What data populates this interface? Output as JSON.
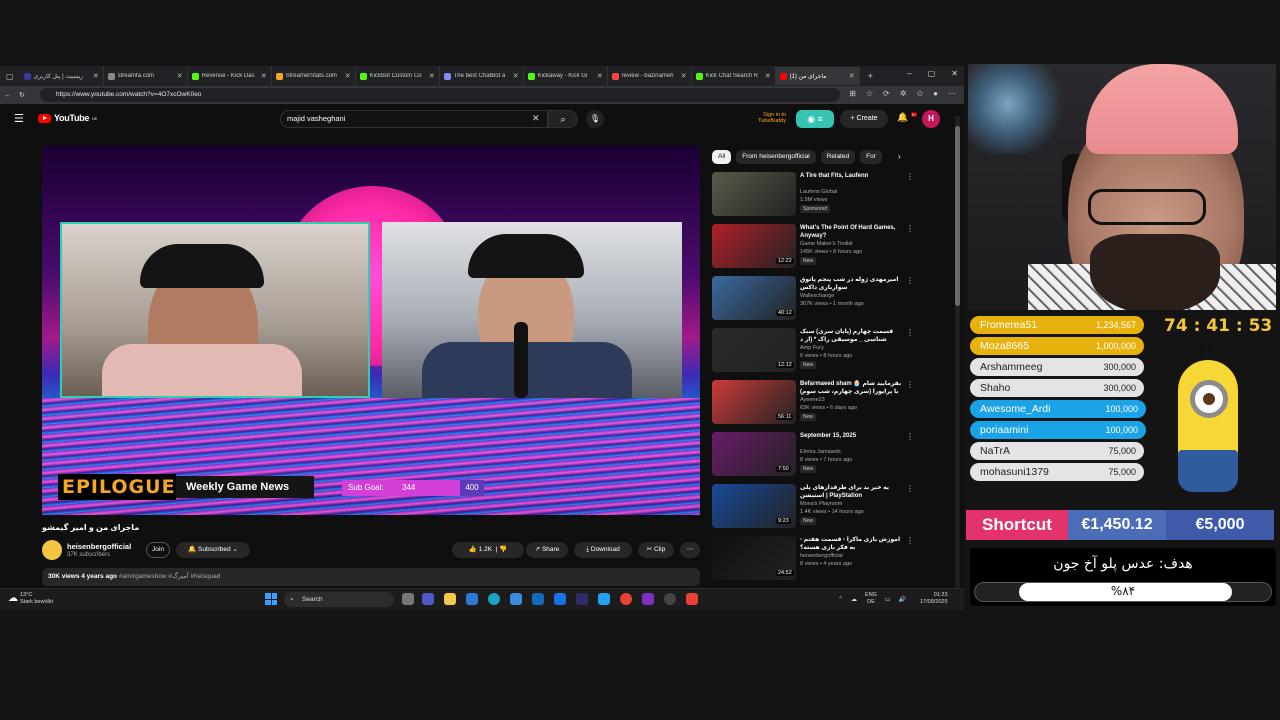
{
  "browser": {
    "tabs": [
      {
        "label": "ریسیت | پنل کاربری",
        "color": "#3a3a9a"
      },
      {
        "label": "streamfa.com",
        "color": "#888888"
      },
      {
        "label": "Revenue - Kick Das",
        "color": "#53fc18"
      },
      {
        "label": "StreamerStats.com",
        "color": "#f5a623"
      },
      {
        "label": "KickBot Custom Co",
        "color": "#53fc18"
      },
      {
        "label": "The best ChatBot a",
        "color": "#8a8aff"
      },
      {
        "label": "Kickaway - Kick Gi",
        "color": "#53fc18"
      },
      {
        "label": "review - bazinameh",
        "color": "#ff4444"
      },
      {
        "label": "Kick Chat Search R",
        "color": "#53fc18"
      },
      {
        "label": "(1) ماجرای من",
        "color": "#ff0000"
      }
    ],
    "url": "https://www.youtube.com/watch?v=4O7xcOwK0eo"
  },
  "youtube": {
    "logo": "YouTube",
    "logo_region": "DE",
    "search_value": "majid vasheghani",
    "tubebuddy": "Sign in to TubeBuddy",
    "create": "Create",
    "notification_count": "9+",
    "avatar_letter": "H",
    "video": {
      "banner": "EPILOGUE",
      "weekly": "Weekly Game News",
      "subgoal_label": "Sub Goal:",
      "subgoal_current": "344",
      "subgoal_max": "400",
      "title": "ماجرای من و امیر گیمشو",
      "channel": "heisenbergofficial",
      "subs": "37K subscribers",
      "join": "Join",
      "subscribed": "Subscribed",
      "likes": "1.2K",
      "share": "Share",
      "download": "Download",
      "clip": "Clip",
      "views": "30K views",
      "age": "4 years ago",
      "tags": "#amirgameshow #آمیرگ #heisquad"
    },
    "chips": [
      "All",
      "From heisenbergofficial",
      "Related",
      "For"
    ],
    "recs": [
      {
        "title": "A Tire that Fits, Laufenn",
        "channel": "Laufenn Global",
        "views": "1.5M views",
        "badge": "Sponsored",
        "dur": "",
        "thumb": "#5a5a4a"
      },
      {
        "title": "What's The Point Of Hard Games, Anyway?",
        "channel": "Game Maker's Toolkit",
        "views": "145K views • 8 hours ago",
        "badge": "New",
        "dur": "12:22",
        "thumb": "#b0202a"
      },
      {
        "title": "امیرمهدی ژوله در شب پنجم پاتوق سوارباری داکس",
        "channel": "Wallexchange",
        "views": "367K views • 1 month ago",
        "badge": "",
        "dur": "40:12",
        "thumb": "#3a6aa0"
      },
      {
        "title": "قسمت چهارم (پایان سری) سبک شناسی _ موسیقی راک * (از د رزولین تا دیسکو",
        "channel": "Amp Fury",
        "views": "6 views • 8 hours ago",
        "badge": "New",
        "dur": "12:12",
        "thumb": "#2a2a2a"
      },
      {
        "title": "Befarmaeed sham 🧁 بفرمایید شام با پرایورا (سری چهارم، شب سوم)",
        "channel": "Ayeene23",
        "views": "63K views • 6 days ago",
        "badge": "New",
        "dur": "56:11",
        "thumb": "#cc3a3a"
      },
      {
        "title": "September 15, 2025",
        "channel": "Elmira Jamasebi",
        "views": "8 views • 7 hours ago",
        "badge": "New",
        "dur": "7:50",
        "thumb": "#6a1a6a"
      },
      {
        "title": "یه خبر بد برای طرفدارهای پلی استیشن | PlayStation",
        "channel": "Mona's Playroom",
        "views": "1.4K views • 14 hours ago",
        "badge": "New",
        "dur": "9:23",
        "thumb": "#1a4a9a"
      },
      {
        "title": "آموزش بازی ماکرا - قسمت هفتم - به فکر بازی هسته؟",
        "channel": "heisenbergofficial",
        "views": "8 views • 4 years ago",
        "badge": "",
        "dur": "24:52",
        "thumb": "#101010"
      }
    ]
  },
  "taskbar": {
    "temp": "13°C",
    "weather": "Stark bewölkt",
    "search": "Search",
    "lang1": "ENG",
    "lang2": "DE",
    "time": "01:23",
    "date": "17/09/2025"
  },
  "overlay": {
    "timer": "74 : 41 : 53",
    "donors": [
      {
        "name": "Fromerea51",
        "amount": "1,234,567",
        "style": "gold"
      },
      {
        "name": "Moza8665",
        "amount": "1,000,000",
        "style": "gold"
      },
      {
        "name": "Arshammeeg",
        "amount": "300,000",
        "style": "grey"
      },
      {
        "name": "Shaho",
        "amount": "300,000",
        "style": "grey"
      },
      {
        "name": "Awesome_Ardi",
        "amount": "100,000",
        "style": "blue"
      },
      {
        "name": "poriaamini",
        "amount": "100,000",
        "style": "blue"
      },
      {
        "name": "NaTrA",
        "amount": "75,000",
        "style": "grey"
      },
      {
        "name": "mohasuni1379",
        "amount": "75,000",
        "style": "grey"
      }
    ],
    "shortcut_label": "Shortcut",
    "shortcut_current": "€1,450.12",
    "shortcut_target": "€5,000",
    "goal_title": "هدف: عدس پلو آخ جون",
    "goal_percent_text": "%۸۴",
    "goal_fraction": 0.84
  }
}
